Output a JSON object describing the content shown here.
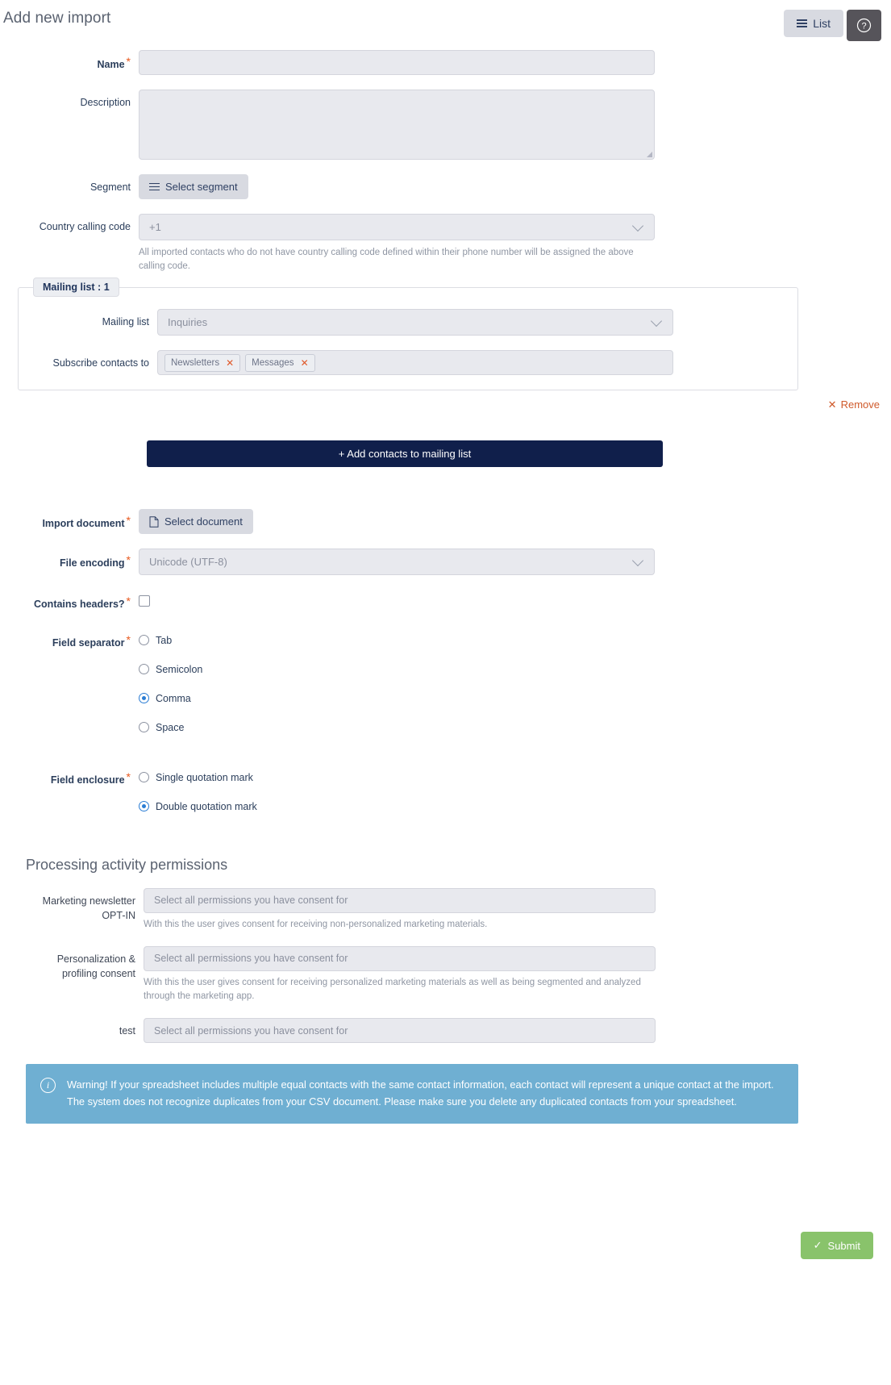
{
  "header": {
    "title": "Add new import",
    "list_button": "List",
    "list_icon": "hamburger-icon",
    "help_icon": "question-circle-icon"
  },
  "form": {
    "name": {
      "label": "Name",
      "required": true,
      "value": "",
      "placeholder": ""
    },
    "description": {
      "label": "Description",
      "required": false,
      "value": "",
      "placeholder": ""
    },
    "segment": {
      "label": "Segment",
      "button_label": "Select segment",
      "icon": "hamburger-icon"
    },
    "country_calling_code": {
      "label": "Country calling code",
      "value": "+1",
      "help": "All imported contacts who do not have country calling code defined within their phone number will be assigned the above calling code."
    }
  },
  "mailing_list_group": {
    "legend": "Mailing list : 1",
    "mailing_list": {
      "label": "Mailing list",
      "value": "Inquiries"
    },
    "subscribe": {
      "label": "Subscribe contacts to",
      "tags": [
        "Newsletters",
        "Messages"
      ],
      "remove_icon": "close-icon"
    },
    "remove": {
      "label": "Remove",
      "icon": "close-icon"
    }
  },
  "add_contacts_button": "+ Add contacts to mailing list",
  "import_settings": {
    "import_document": {
      "label": "Import document",
      "required": true,
      "button_label": "Select document",
      "icon": "document-icon"
    },
    "file_encoding": {
      "label": "File encoding",
      "required": true,
      "value": "Unicode (UTF-8)"
    },
    "contains_headers": {
      "label": "Contains headers?",
      "required": true,
      "checked": false
    },
    "field_separator": {
      "label": "Field separator",
      "required": true,
      "options": [
        "Tab",
        "Semicolon",
        "Comma",
        "Space"
      ],
      "selected": "Comma"
    },
    "field_enclosure": {
      "label": "Field enclosure",
      "required": true,
      "options": [
        "Single quotation mark",
        "Double quotation mark"
      ],
      "selected": "Double quotation mark"
    }
  },
  "permissions": {
    "section_title": "Processing activity permissions",
    "placeholder": "Select all permissions you have consent for",
    "items": [
      {
        "label": "Marketing newsletter OPT-IN",
        "label_line1": "Marketing newsletter",
        "label_line2": "OPT-IN",
        "value": "",
        "help": "With this the user gives consent for receiving non-personalized marketing materials."
      },
      {
        "label": "Personalization & profiling consent",
        "label_line1": "Personalization &",
        "label_line2": "profiling consent",
        "value": "",
        "help": "With this the user gives consent for receiving personalized marketing materials as well as being segmented and analyzed through the marketing app."
      },
      {
        "label": "test",
        "label_line1": "test",
        "label_line2": "",
        "value": "",
        "help": ""
      }
    ]
  },
  "alert": {
    "icon": "info-circle-icon",
    "text": "Warning! If your spreadsheet includes multiple equal contacts with the same contact information, each contact will represent a unique contact at the import. The system does not recognize duplicates from your CSV document. Please make sure you delete any duplicated contacts from your spreadsheet."
  },
  "footer": {
    "submit_label": "Submit",
    "submit_icon": "check-icon"
  },
  "colors": {
    "accent_navy": "#101f4b",
    "required_star": "#e8591e",
    "remove_link": "#cf5a2b",
    "radio_selected": "#2b7dd4",
    "alert_bg": "#6fafd2",
    "submit_bg": "#89c36b",
    "input_bg": "#e8e9ee"
  }
}
